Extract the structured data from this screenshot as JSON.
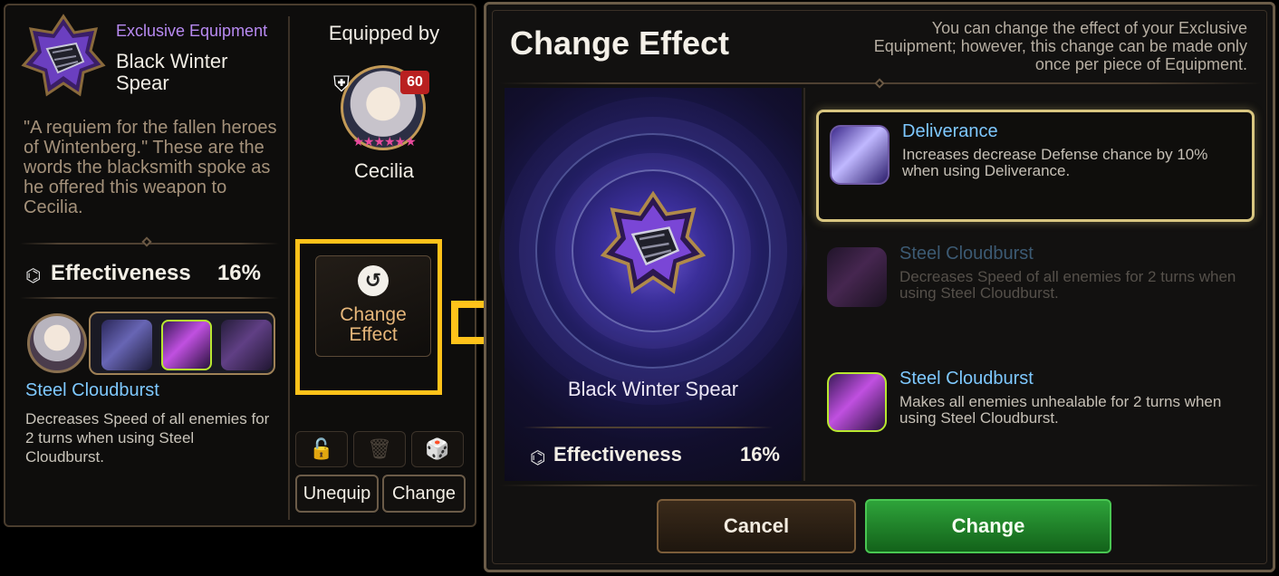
{
  "left_panel": {
    "equip_type": "Exclusive Equipment",
    "equip_name": "Black Winter Spear",
    "equip_description": "\"A requiem for the fallen heroes of Wintenberg.\" These are the words the blacksmith spoke as he offered this weapon to Cecilia.",
    "effectiveness_label": "Effectiveness",
    "effectiveness_value": "16%",
    "skill_name": "Steel Cloudburst",
    "skill_description": "Decreases Speed of all enemies for 2 turns when using Steel Cloudburst.",
    "equipped_by_label": "Equipped by",
    "hero_level": "60",
    "hero_name": "Cecilia",
    "hero_stars": "★★★★★★",
    "change_effect_label": "Change Effect",
    "unequip_label": "Unequip",
    "change_label": "Change"
  },
  "icons": {
    "lock": "🔓",
    "trash": "🗑",
    "dice": "🎲",
    "shield": "⛨",
    "effectiveness": "⌬",
    "refresh": "↺"
  },
  "dialog": {
    "title": "Change Effect",
    "note": "You can change the effect of your Exclusive Equipment; however, this change can be made only once per piece of Equipment.",
    "preview_name": "Black Winter Spear",
    "effectiveness_label": "Effectiveness",
    "effectiveness_value": "16%",
    "options": [
      {
        "title": "Deliverance",
        "description": "Increases decrease Defense chance by 10% when using Deliverance.",
        "state": "selected"
      },
      {
        "title": "Steel Cloudburst",
        "description": "Decreases Speed of all enemies for 2 turns when using Steel Cloudburst.",
        "state": "disabled"
      },
      {
        "title": "Steel Cloudburst",
        "description": "Makes all enemies unhealable for 2 turns when using Steel Cloudburst.",
        "state": "normal"
      }
    ],
    "cancel_label": "Cancel",
    "change_label": "Change"
  },
  "colors": {
    "highlight": "#ffc21a",
    "accent_blue": "#7ec8ff",
    "exclusive_purple": "#b88af2",
    "confirm_green": "#2ea33a"
  }
}
